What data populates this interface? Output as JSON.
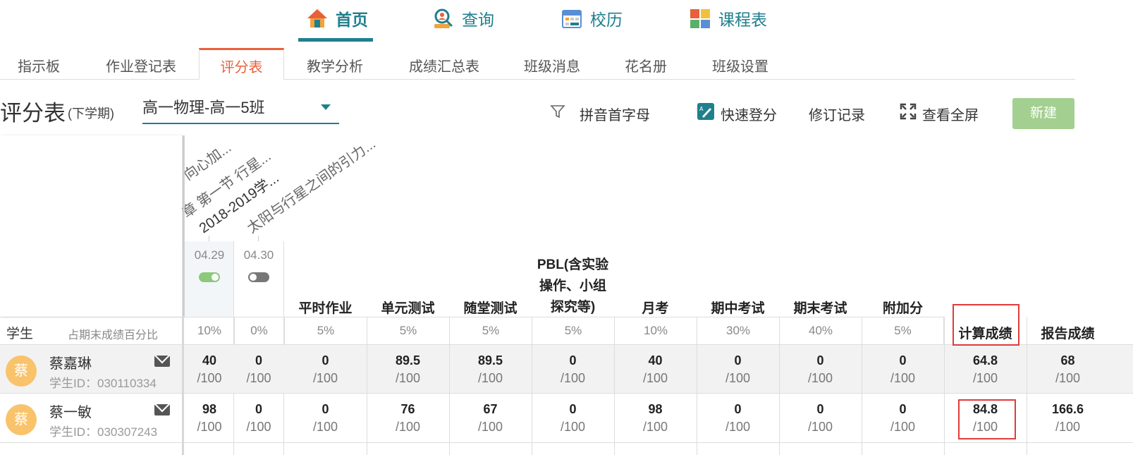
{
  "topnav": [
    {
      "label": "首页",
      "icon": "home-icon",
      "active": true
    },
    {
      "label": "查询",
      "icon": "search-person-icon",
      "active": false
    },
    {
      "label": "校历",
      "icon": "calendar-icon",
      "active": false
    },
    {
      "label": "课程表",
      "icon": "schedule-icon",
      "active": false
    }
  ],
  "tabs": [
    "指示板",
    "作业登记表",
    "评分表",
    "教学分析",
    "成绩汇总表",
    "班级消息",
    "花名册",
    "班级设置"
  ],
  "active_tab": "评分表",
  "page": {
    "title": "评分表",
    "term": "(下学期)",
    "class_select": "高一物理-高一5班"
  },
  "toolbar": {
    "filter_label": "拼音首字母",
    "quick_label": "快速登分",
    "history_label": "修订记录",
    "fullscreen_label": "查看全屏",
    "new_label": "新建"
  },
  "assignments": [
    {
      "title": "向心加...",
      "date": "04.29",
      "enabled": true
    },
    {
      "title": "章 第一节 行星...",
      "date": "04.30",
      "enabled": false
    },
    {
      "title": "2018-2019学...",
      "date": "",
      "enabled": null
    },
    {
      "title": "太阳与行星之间的引力...",
      "date": "",
      "enabled": null
    }
  ],
  "table": {
    "student_header": "学生",
    "percent_header": "占期末成绩百分比",
    "assignment_weights": [
      "10%",
      "0%"
    ],
    "categories": [
      {
        "name": "平时作业",
        "weight": "5%"
      },
      {
        "name": "单元测试",
        "weight": "5%"
      },
      {
        "name": "随堂测试",
        "weight": "5%"
      },
      {
        "name": "PBL(含实验操作、小组探究等)",
        "name_lines": [
          "PBL(含实验",
          "操作、小组",
          "探究等)"
        ],
        "weight": "5%"
      },
      {
        "name": "月考",
        "weight": "10%"
      },
      {
        "name": "期中考试",
        "weight": "30%"
      },
      {
        "name": "期末考试",
        "weight": "40%"
      },
      {
        "name": "附加分",
        "weight": "5%"
      }
    ],
    "computed_header": "计算成绩",
    "report_header": "报告成绩",
    "denominator": "/100",
    "students": [
      {
        "avatar": "蔡",
        "name": "蔡嘉琳",
        "id": "学生ID：030110334",
        "values": [
          "40",
          "0",
          "0",
          "89.5",
          "89.5",
          "0",
          "40",
          "0",
          "0",
          "0",
          "64.8",
          "68"
        ]
      },
      {
        "avatar": "蔡",
        "name": "蔡一敏",
        "id": "学生ID：030307243",
        "values": [
          "98",
          "0",
          "0",
          "76",
          "67",
          "0",
          "98",
          "0",
          "0",
          "0",
          "84.8",
          "166.6"
        ]
      }
    ]
  },
  "colors": {
    "accent": "#1f7f8d",
    "active_tab": "#e8603a",
    "new_button": "#a3cf91",
    "highlight": "#e03b3b",
    "avatar": "#f9c36b"
  }
}
